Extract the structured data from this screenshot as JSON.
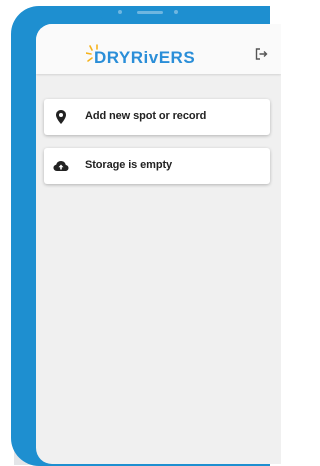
{
  "app": {
    "logo_text": "DRYRivERS",
    "logout_icon": "logout-icon",
    "colors": {
      "frame": "#1e8fd0",
      "logo_blue": "#2a8ed8",
      "logo_yellow": "#f6b31d"
    }
  },
  "main": {
    "items": [
      {
        "icon": "map-marker-icon",
        "label": "Add new spot or record"
      },
      {
        "icon": "cloud-upload-icon",
        "label": "Storage is empty"
      }
    ]
  }
}
